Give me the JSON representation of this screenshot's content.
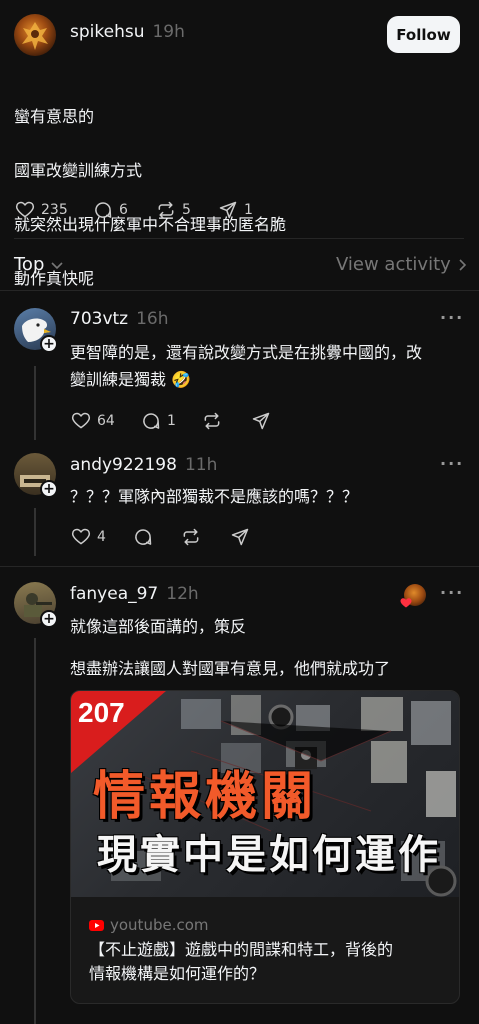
{
  "post": {
    "username": "spikehsu",
    "time": "19h",
    "follow_label": "Follow",
    "lines": [
      "蠻有意思的",
      "國軍改變訓練方式",
      "就突然出現什麼軍中不合理事的匿名脆",
      "動作真快呢"
    ],
    "likes": "235",
    "replies": "6",
    "reposts": "5",
    "shares": "1"
  },
  "sort": {
    "label": "Top",
    "view_activity": "View activity"
  },
  "comments": [
    {
      "username": "703vtz",
      "time": "16h",
      "text": "更智障的是，還有說改變方式是在挑釁中國的，改\n變訓練是獨裁 🤣",
      "likes": "64",
      "replies": "1"
    },
    {
      "username": "andy922198",
      "time": "11h",
      "text": "？？？軍隊內部獨裁不是應該的嗎？？？",
      "likes": "4"
    },
    {
      "username": "fanyea_97",
      "time": "12h",
      "text1": "就像這部後面講的，策反",
      "text2": "想盡辦法讓國人對國軍有意見，他們就成功了",
      "card": {
        "badge": "207",
        "headline1": "情報機關",
        "headline2": "現實中是如何運作",
        "source": "youtube.com",
        "title": "【不止遊戲】遊戲中的間諜和特工，背後的\n情報機構是如何運作的？"
      }
    }
  ],
  "colors": {
    "background": "#101010",
    "text": "#f3f5f7",
    "muted": "#777777",
    "youtube_red": "#ff0000",
    "badge_red": "#d91d1d",
    "headline_orange": "#f25a2a"
  }
}
